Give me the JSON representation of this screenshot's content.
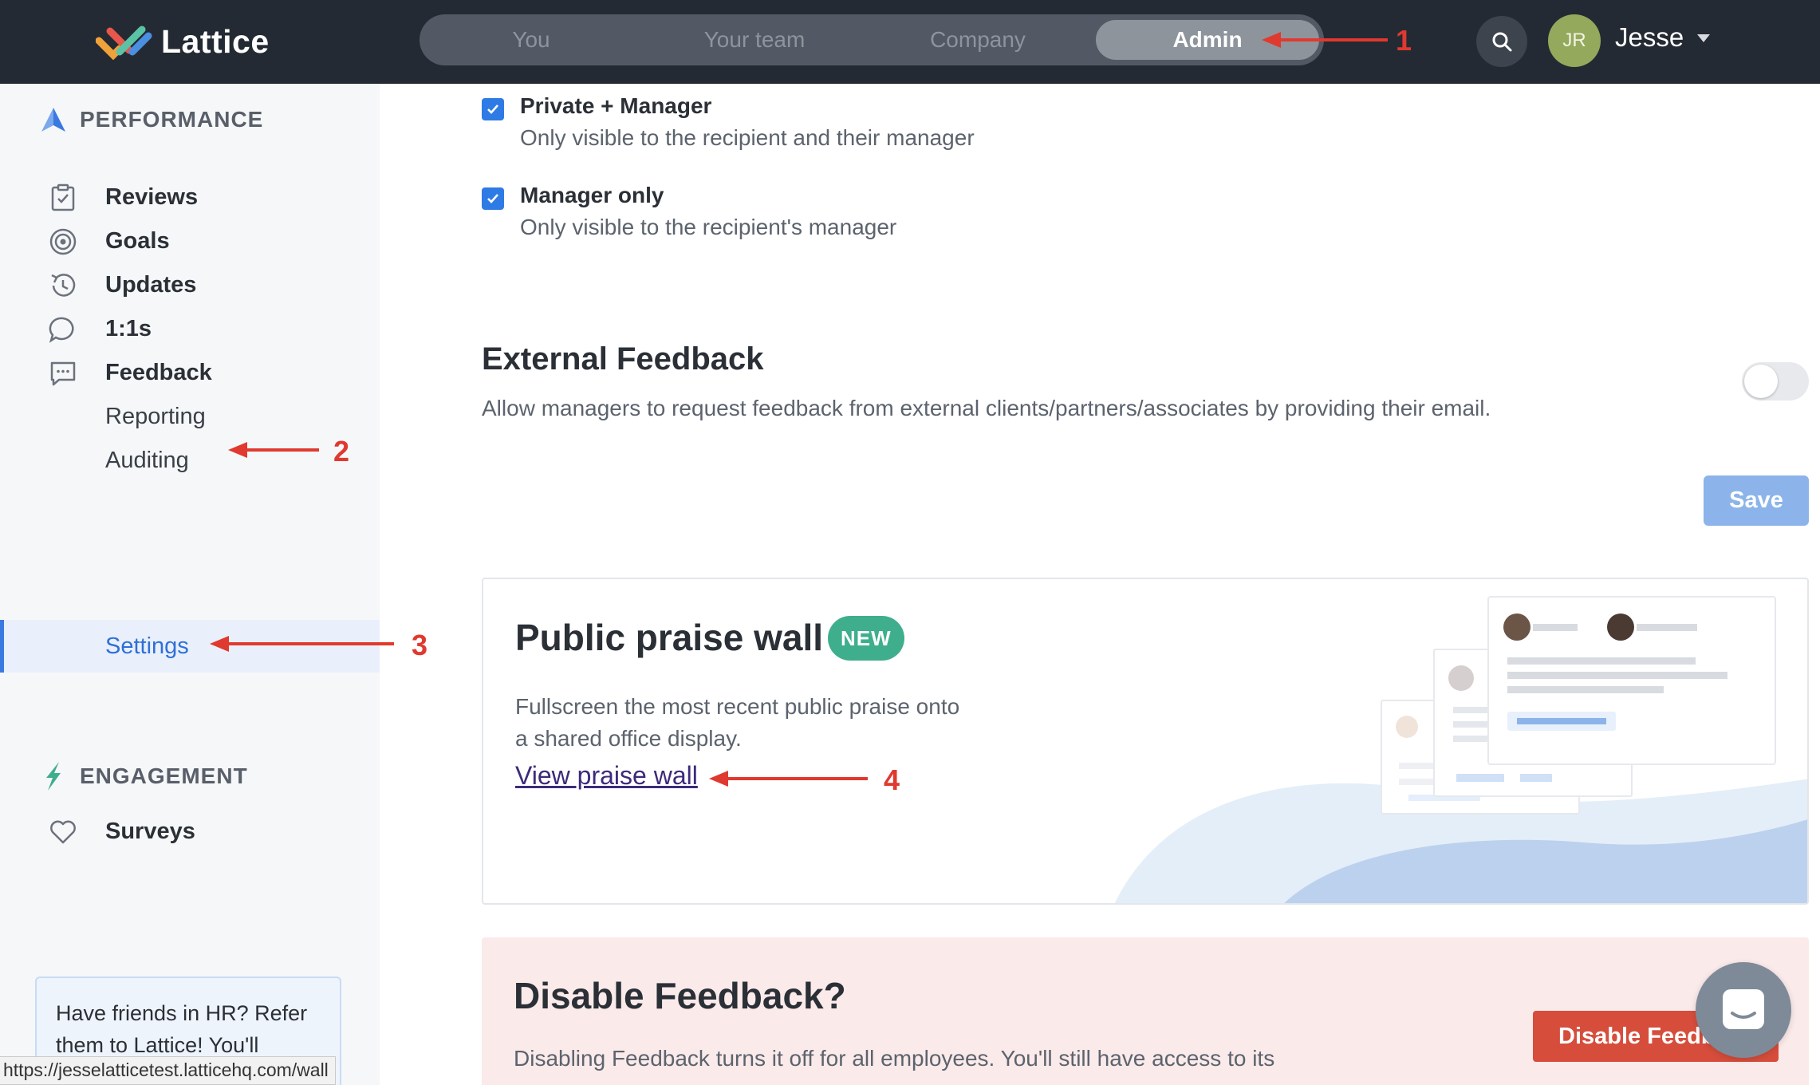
{
  "app": {
    "name": "Lattice"
  },
  "nav": {
    "tabs": [
      {
        "label": "You",
        "active": false
      },
      {
        "label": "Your team",
        "active": false
      },
      {
        "label": "Company",
        "active": false
      },
      {
        "label": "Admin",
        "active": true
      }
    ]
  },
  "user": {
    "initials": "JR",
    "name": "Jesse",
    "avatar_color": "#95a95c"
  },
  "sidebar": {
    "performance_label": "PERFORMANCE",
    "items": [
      {
        "label": "Reviews",
        "icon": "clipboard-check-icon"
      },
      {
        "label": "Goals",
        "icon": "target-icon"
      },
      {
        "label": "Updates",
        "icon": "history-icon"
      },
      {
        "label": "1:1s",
        "icon": "chat-bubble-icon"
      },
      {
        "label": "Feedback",
        "icon": "message-icon"
      }
    ],
    "sub_items": [
      {
        "label": "Reporting"
      },
      {
        "label": "Auditing"
      },
      {
        "label": "Settings",
        "active": true
      }
    ],
    "engagement_label": "ENGAGEMENT",
    "engagement_items": [
      {
        "label": "Surveys",
        "icon": "heart-icon"
      }
    ],
    "refer_text": "Have friends in HR? Refer them to Lattice! You'll"
  },
  "status_bar": {
    "url": "https://jesselatticetest.latticehq.com/wall"
  },
  "main": {
    "visibility_options": [
      {
        "title": "Private + Manager",
        "description": "Only visible to the recipient and their manager",
        "checked": true
      },
      {
        "title": "Manager only",
        "description": "Only visible to the recipient's manager",
        "checked": true
      }
    ],
    "external_feedback": {
      "title": "External Feedback",
      "description": "Allow managers to request feedback from external clients/partners/associates by providing their email.",
      "enabled": false
    },
    "save_label": "Save",
    "praise_wall": {
      "title": "Public praise wall",
      "badge": "NEW",
      "description": "Fullscreen the most recent public praise onto a shared office display.",
      "link": "View praise wall"
    },
    "disable": {
      "title": "Disable Feedback?",
      "description": "Disabling Feedback turns it off for all employees. You'll still have access to its configurations in read-only mode and can turn it back on at any time.",
      "button": "Disable Feedback"
    }
  },
  "annotations": [
    "1",
    "2",
    "3",
    "4"
  ],
  "colors": {
    "topbar": "#242a33",
    "accent_blue": "#2f7be5",
    "new_badge": "#3fae8c",
    "danger": "#d64d3c",
    "annotation": "#e0392f"
  }
}
